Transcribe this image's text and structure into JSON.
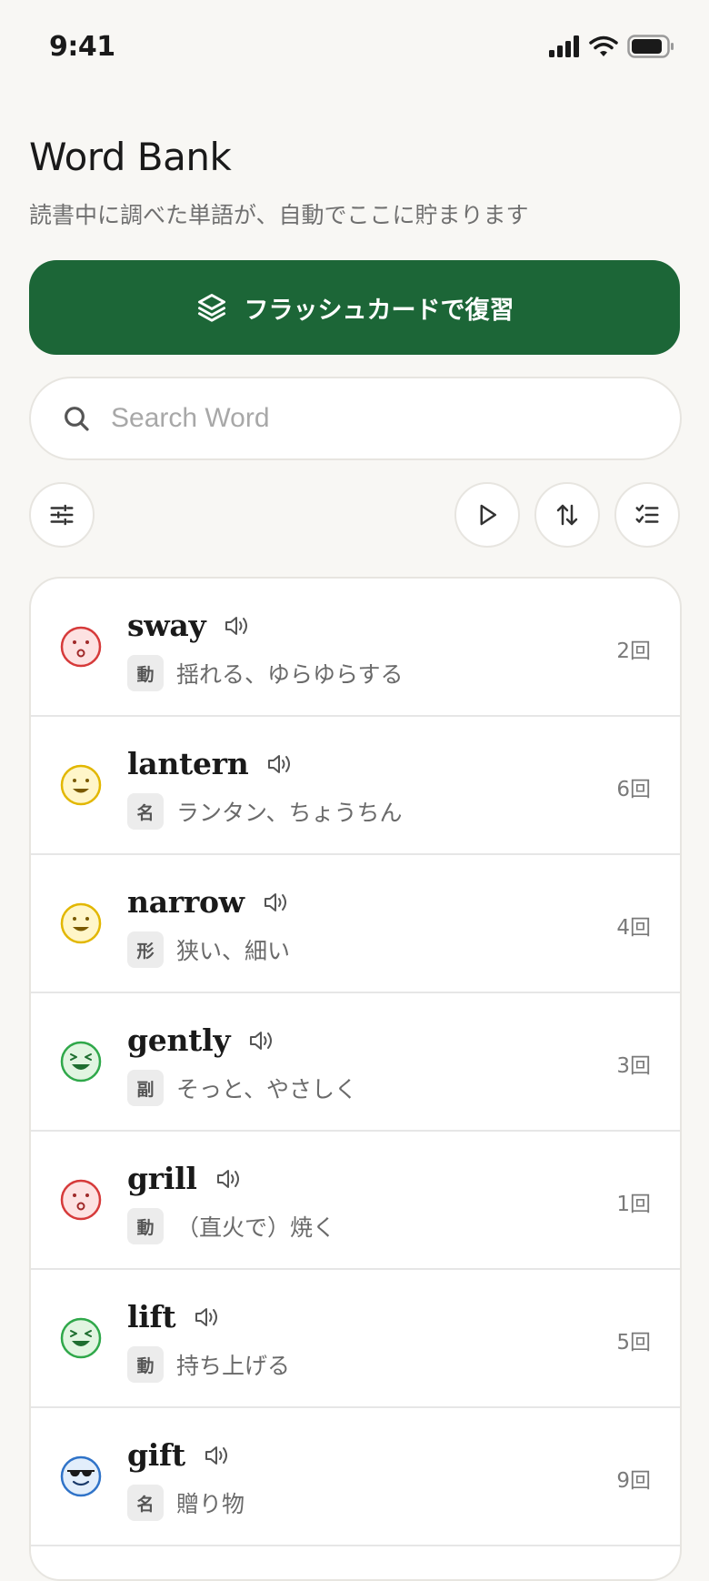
{
  "status": {
    "time": "9:41"
  },
  "header": {
    "title": "Word Bank",
    "subtitle": "読書中に調べた単語が、自動でここに貯まります"
  },
  "flashcard_button": {
    "label": "フラッシュカードで復習"
  },
  "search": {
    "placeholder": "Search Word",
    "value": ""
  },
  "toolbar": {
    "filter_icon": "sliders-icon",
    "play_icon": "play-icon",
    "sort_icon": "sort-arrows-icon",
    "select_icon": "checklist-icon"
  },
  "colors": {
    "primary": "#1c6637",
    "background": "#f8f7f4"
  },
  "words": [
    {
      "word": "sway",
      "pos": "動",
      "meaning": "揺れる、ゆらゆらする",
      "count": "2回",
      "face": "surprised-face-icon",
      "face_color": "red"
    },
    {
      "word": "lantern",
      "pos": "名",
      "meaning": "ランタン、ちょうちん",
      "count": "6回",
      "face": "smile-face-icon",
      "face_color": "yellow"
    },
    {
      "word": "narrow",
      "pos": "形",
      "meaning": "狭い、細い",
      "count": "4回",
      "face": "smile-face-icon",
      "face_color": "yellow"
    },
    {
      "word": "gently",
      "pos": "副",
      "meaning": "そっと、やさしく",
      "count": "3回",
      "face": "grin-face-icon",
      "face_color": "green"
    },
    {
      "word": "grill",
      "pos": "動",
      "meaning": "（直火で）焼く",
      "count": "1回",
      "face": "surprised-face-icon",
      "face_color": "red"
    },
    {
      "word": "lift",
      "pos": "動",
      "meaning": "持ち上げる",
      "count": "5回",
      "face": "grin-face-icon",
      "face_color": "green"
    },
    {
      "word": "gift",
      "pos": "名",
      "meaning": "贈り物",
      "count": "9回",
      "face": "sunglasses-face-icon",
      "face_color": "blue"
    }
  ]
}
